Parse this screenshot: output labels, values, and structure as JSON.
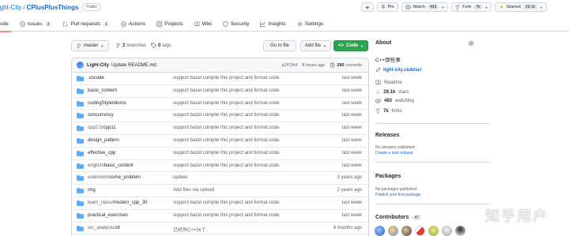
{
  "repo": {
    "owner": "ight-City",
    "separator": "/",
    "name": "CPlusPlusThings",
    "visibility": "Public"
  },
  "header_actions": {
    "pin_label": "Pin",
    "watch_label": "Watch",
    "watch_count": "493",
    "fork_label": "Fork",
    "fork_count": "7k",
    "star_label": "Starred",
    "star_count": "29.1k"
  },
  "tabs": [
    {
      "label": "ode",
      "icon": "code-icon",
      "active": true
    },
    {
      "label": "Issues",
      "count": "3",
      "icon": "issue-icon"
    },
    {
      "label": "Pull requests",
      "count": "1",
      "icon": "pull-request-icon"
    },
    {
      "label": "Actions",
      "icon": "play-icon"
    },
    {
      "label": "Projects",
      "icon": "table-icon"
    },
    {
      "label": "Wiki",
      "icon": "book-icon"
    },
    {
      "label": "Security",
      "icon": "shield-icon"
    },
    {
      "label": "Insights",
      "icon": "graph-icon"
    },
    {
      "label": "Settings",
      "icon": "gear-icon"
    }
  ],
  "toolbar": {
    "branch": "master",
    "branches_count": "2",
    "branches_label": "branches",
    "tags_count": "0",
    "tags_label": "tags",
    "goto_file": "Go to file",
    "add_file": "Add file",
    "code": "Code"
  },
  "commit": {
    "author": "Light-City",
    "message": "Update README.md",
    "sha": "a1f7244",
    "time": "8 hours ago",
    "commits_count": "295",
    "commits_label": "commits"
  },
  "files": [
    {
      "prefix": "",
      "name": ".vscode",
      "message": "support bazel complie this project and format code.",
      "age": "last week"
    },
    {
      "prefix": "",
      "name": "basic_content",
      "message": "support bazel complie this project and format code.",
      "age": "last week"
    },
    {
      "prefix": "",
      "name": "codingStyleIdioms",
      "message": "support bazel complie this project and format code.",
      "age": "last week"
    },
    {
      "prefix": "",
      "name": "concurrency",
      "message": "support bazel complie this project and format code.",
      "age": "last week"
    },
    {
      "prefix": "cpp2.0/",
      "name": "cpp11",
      "message": "support bazel complie this project and format code.",
      "age": "last week"
    },
    {
      "prefix": "",
      "name": "design_pattern",
      "message": "support bazel complie this project and format code.",
      "age": "last week"
    },
    {
      "prefix": "",
      "name": "effective_cpp",
      "message": "support bazel complie this project and format code.",
      "age": "last week"
    },
    {
      "prefix": "english/",
      "name": "basic_content",
      "message": "support bazel complie this project and format code.",
      "age": "last week"
    },
    {
      "prefix": "extension/",
      "name": "some_problem",
      "message": "update",
      "age": "3 years ago"
    },
    {
      "prefix": "",
      "name": "img",
      "message": "Add files via upload",
      "age": "2 years ago"
    },
    {
      "prefix": "learn_class/",
      "name": "modern_cpp_30",
      "message": "support bazel complie this project and format code.",
      "age": "last week"
    },
    {
      "prefix": "",
      "name": "practical_exercises",
      "message": "support bazel complie this project and format code.",
      "age": "last week"
    },
    {
      "prefix": "src_analysis/",
      "name": "stl",
      "message": "已经有C++0x了",
      "age": "4 months ago"
    }
  ],
  "about": {
    "title": "About",
    "description": "C++那些事",
    "website": "light-city.club/sc/",
    "readme": "Readme",
    "stars_value": "29.1k",
    "stars_label": "stars",
    "watching_value": "493",
    "watching_label": "watching",
    "forks_value": "7k",
    "forks_label": "forks"
  },
  "releases": {
    "title": "Releases",
    "empty": "No releases published",
    "create": "Create a new release"
  },
  "packages": {
    "title": "Packages",
    "empty": "No packages published",
    "publish": "Publish your first package"
  },
  "contributors": {
    "title": "Contributors",
    "count": "47"
  },
  "watermark": "知乎用户",
  "colors": {
    "link": "#0969da",
    "code_button": "#2da44e",
    "active_tab_underline": "#fd8c73",
    "folder": "#54aeff"
  }
}
